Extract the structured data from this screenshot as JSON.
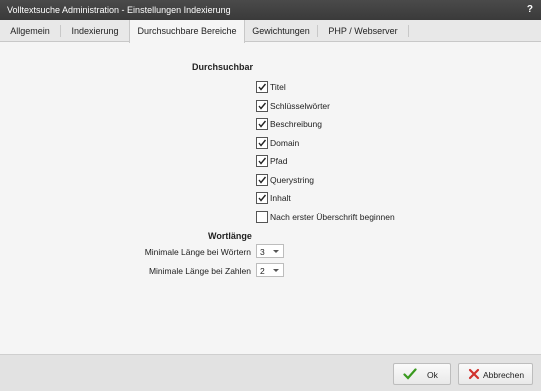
{
  "window": {
    "title": "Volltextsuche Administration - Einstellungen Indexierung",
    "help_label": "?"
  },
  "tabs": [
    {
      "label": "Allgemein",
      "active": false
    },
    {
      "label": "Indexierung",
      "active": false
    },
    {
      "label": "Durchsuchbare Bereiche",
      "active": true
    },
    {
      "label": "Gewichtungen",
      "active": false
    },
    {
      "label": "PHP / Webserver",
      "active": false
    }
  ],
  "searchable": {
    "heading": "Durchsuchbar",
    "options": [
      {
        "label": "Titel",
        "checked": true
      },
      {
        "label": "Schlüsselwörter",
        "checked": true
      },
      {
        "label": "Beschreibung",
        "checked": true
      },
      {
        "label": "Domain",
        "checked": true
      },
      {
        "label": "Pfad",
        "checked": true
      },
      {
        "label": "Querystring",
        "checked": true
      },
      {
        "label": "Inhalt",
        "checked": true
      },
      {
        "label": "Nach erster Überschrift beginnen",
        "checked": false
      }
    ]
  },
  "word_length": {
    "heading": "Wortlänge",
    "min_words_label": "Minimale Länge bei Wörtern",
    "min_words_value": "3",
    "min_numbers_label": "Minimale Länge bei Zahlen",
    "min_numbers_value": "2"
  },
  "footer": {
    "ok_label": "Ok",
    "cancel_label": "Abbrechen"
  },
  "colors": {
    "titlebar": "#3f3f3f",
    "ok_icon": "#3a9a1f",
    "cancel_icon": "#d0312d"
  }
}
